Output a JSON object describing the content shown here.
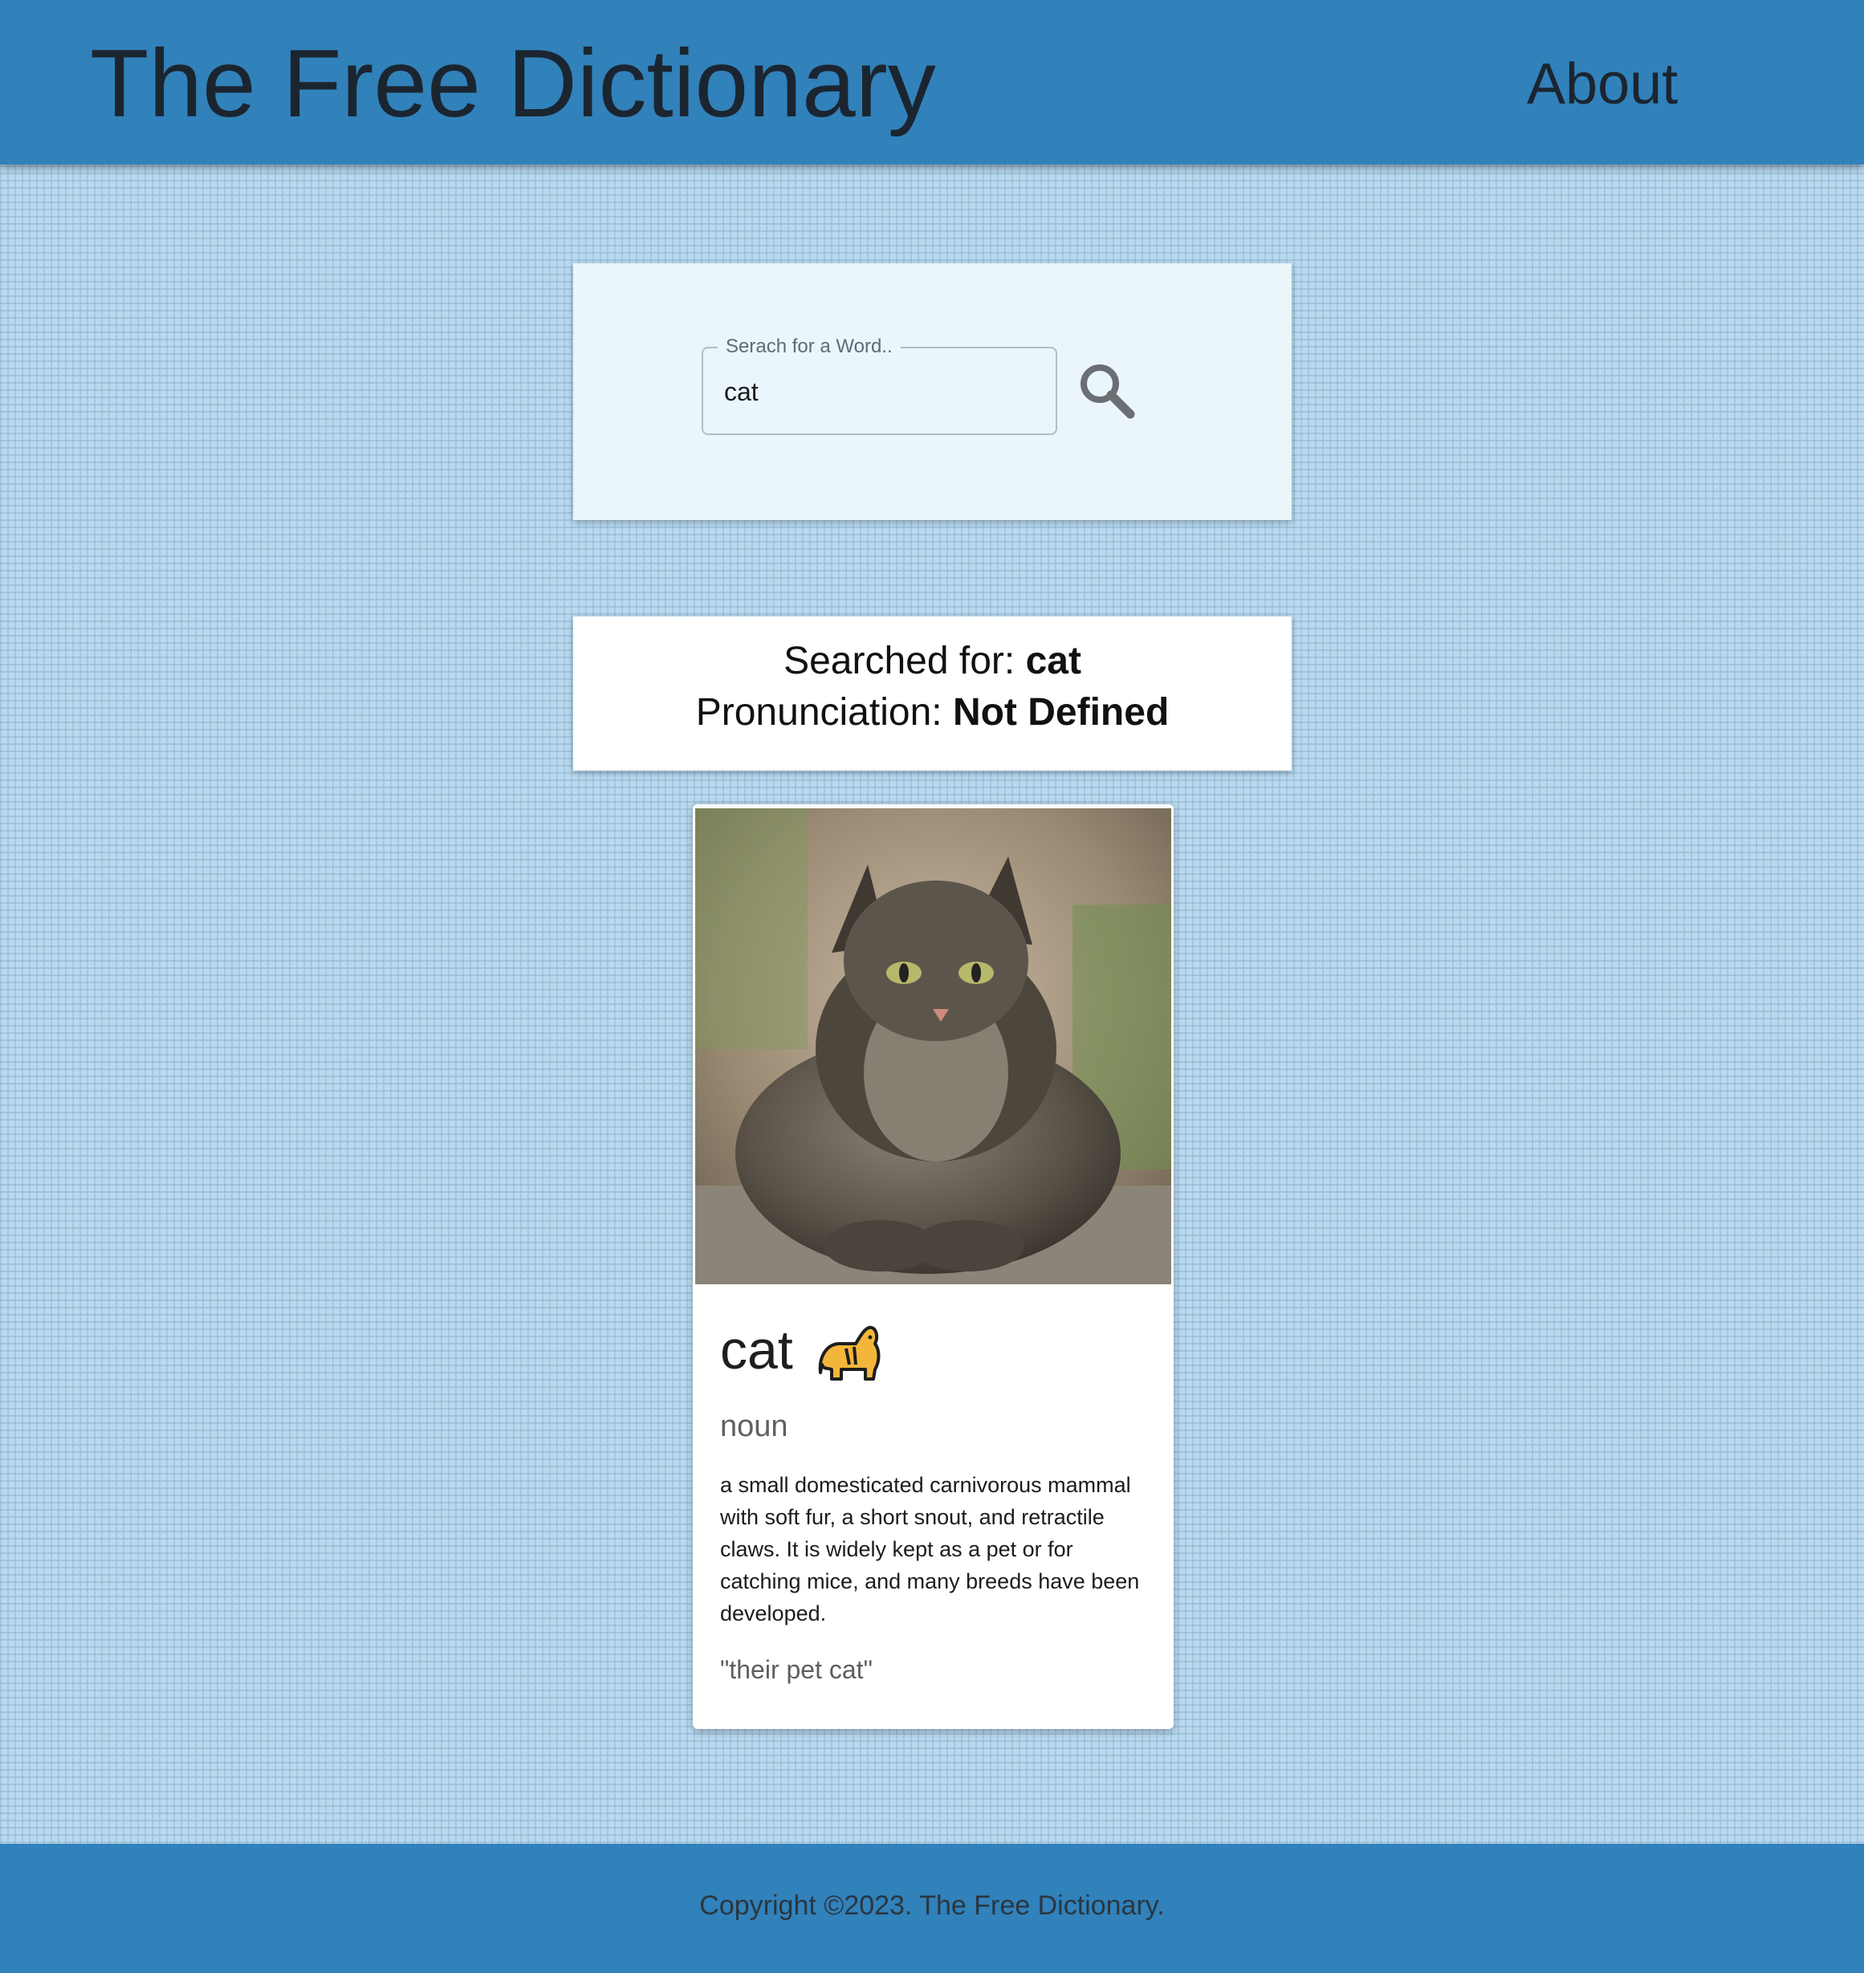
{
  "header": {
    "title": "The Free Dictionary",
    "nav_about": "About"
  },
  "search": {
    "label": "Serach for a Word..",
    "value": "cat",
    "button_icon": "search-icon"
  },
  "result": {
    "searched_prefix": "Searched for: ",
    "searched_word": "cat",
    "pronunciation_prefix": "Pronunciation: ",
    "pronunciation_value": "Not Defined"
  },
  "definition_card": {
    "image_subject": "photo of a tabby cat",
    "word": "cat",
    "word_icon": "cat-icon",
    "part_of_speech": "noun",
    "definition": "a small domesticated carnivorous mammal with soft fur, a short snout, and retractile claws. It is widely kept as a pet or for catching mice, and many breeds have been developed.",
    "example": "\"their pet cat\""
  },
  "footer": {
    "copyright": "Copyright ©2023. The Free Dictionary."
  },
  "colors": {
    "header_bg": "#3181ba",
    "search_card_bg": "#eaf6fc",
    "page_bg": "#b7d8ee"
  }
}
